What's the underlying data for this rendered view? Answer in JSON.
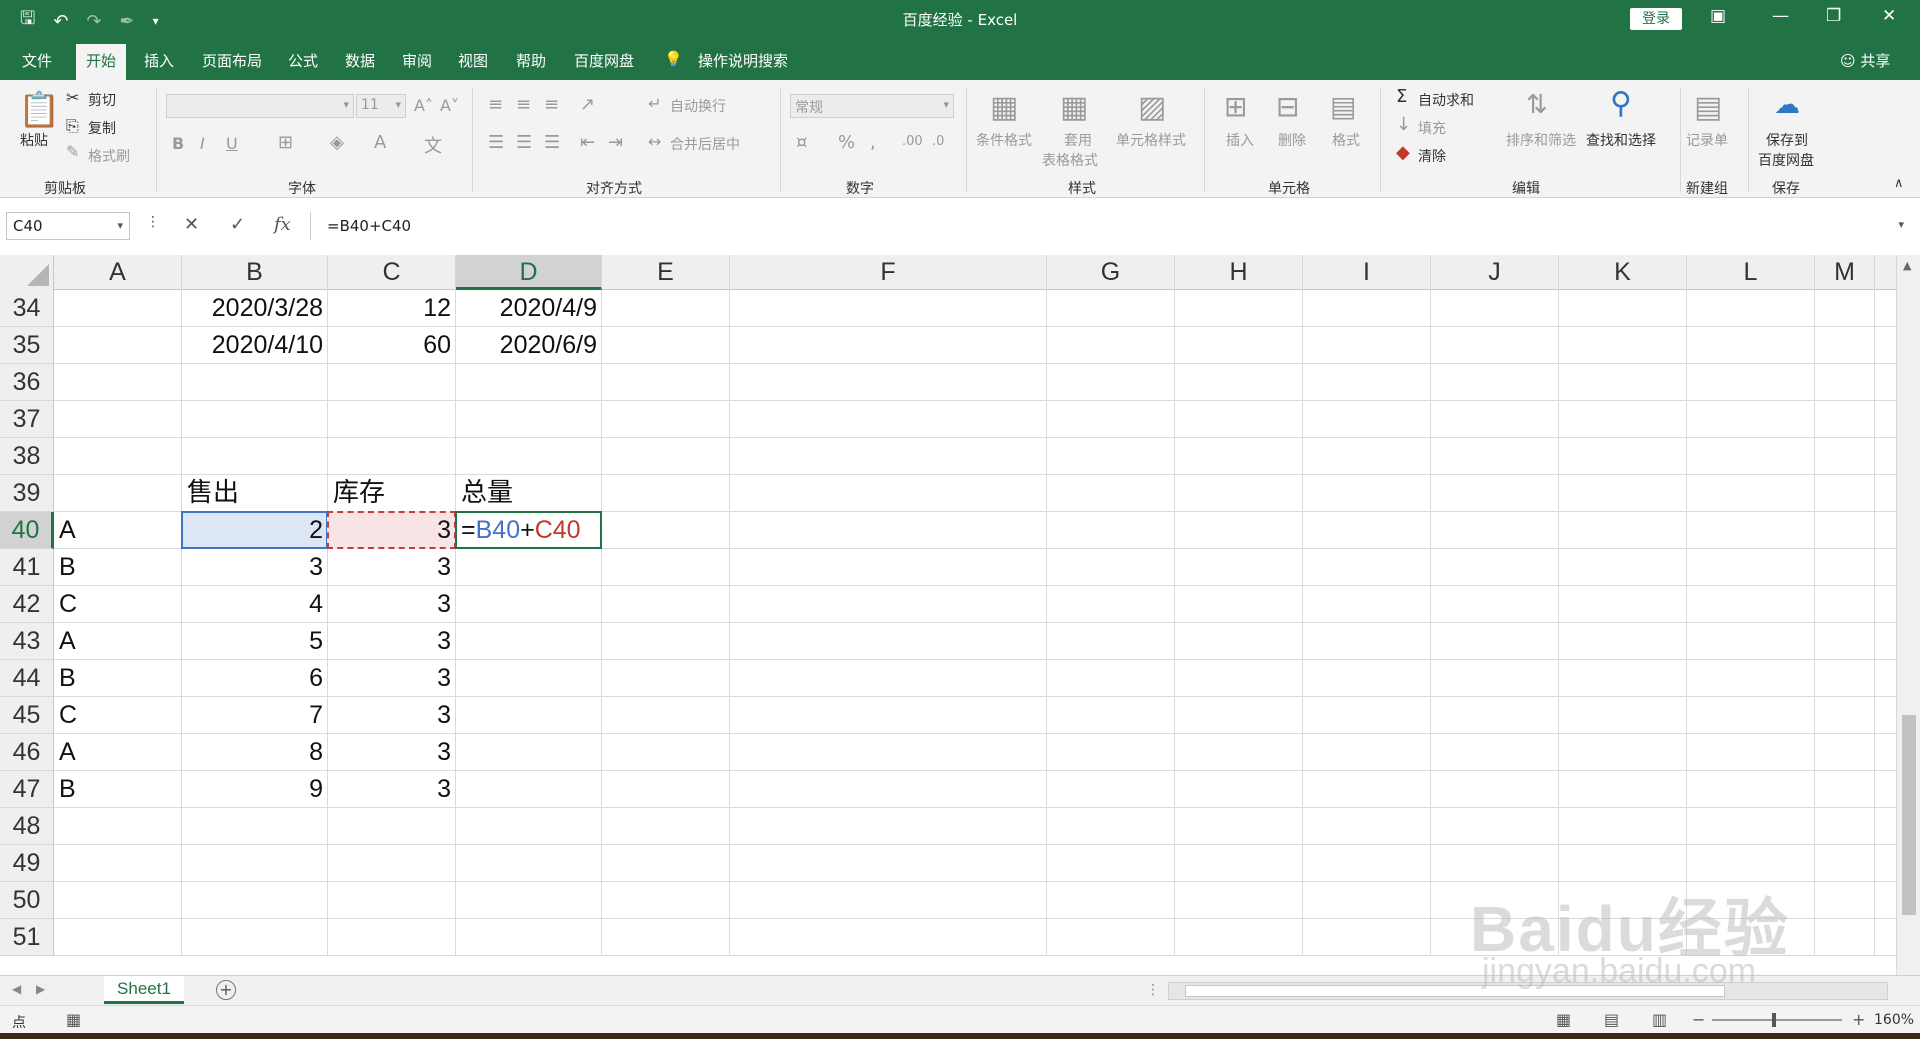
{
  "window": {
    "title": "百度经验  -  Excel",
    "login_label": "登录",
    "share_label": "共享"
  },
  "ribbon": {
    "tabs": [
      {
        "label": "文件"
      },
      {
        "label": "开始"
      },
      {
        "label": "插入"
      },
      {
        "label": "页面布局"
      },
      {
        "label": "公式"
      },
      {
        "label": "数据"
      },
      {
        "label": "审阅"
      },
      {
        "label": "视图"
      },
      {
        "label": "帮助"
      },
      {
        "label": "百度网盘"
      },
      {
        "label": "操作说明搜索"
      }
    ],
    "active_tab": "开始",
    "clipboard": {
      "paste": "粘贴",
      "cut": "剪切",
      "copy": "复制",
      "format_painter": "格式刷",
      "group_label": "剪贴板"
    },
    "font": {
      "font_size": "11",
      "group_label": "字体"
    },
    "alignment": {
      "wrap_text": "自动换行",
      "merge_center": "合并后居中",
      "group_label": "对齐方式"
    },
    "number": {
      "format": "常规",
      "group_label": "数字"
    },
    "styles": {
      "conditional": "条件格式",
      "table_format_1": "套用",
      "table_format_2": "表格格式",
      "cell_styles": "单元格样式",
      "group_label": "样式"
    },
    "cells": {
      "insert": "插入",
      "delete": "删除",
      "format": "格式",
      "group_label": "单元格"
    },
    "editing": {
      "autosum": "自动求和",
      "fill": "填充",
      "clear": "清除",
      "sort_filter": "排序和筛选",
      "find_select": "查找和选择",
      "group_label": "编辑"
    },
    "new_group": {
      "record": "记录单",
      "group_label": "新建组"
    },
    "save": {
      "save_to_1": "保存到",
      "save_to_2": "百度网盘",
      "group_label": "保存"
    }
  },
  "formula_bar": {
    "name_box": "C40",
    "formula": "=B40+C40",
    "fx_label": "fx"
  },
  "grid": {
    "columns": [
      "A",
      "B",
      "C",
      "D",
      "E",
      "F",
      "G",
      "H",
      "I",
      "J",
      "K",
      "L",
      "M"
    ],
    "selected_column": "D",
    "rows": [
      "34",
      "35",
      "36",
      "37",
      "38",
      "39",
      "40",
      "41",
      "42",
      "43",
      "44",
      "45",
      "46",
      "47",
      "48",
      "49",
      "50",
      "51"
    ],
    "selected_row": "40",
    "cells": {
      "B34": "2020/3/28",
      "C34": "12",
      "D34": "2020/4/9",
      "B35": "2020/4/10",
      "C35": "60",
      "D35": "2020/6/9",
      "B39": "售出",
      "C39": "库存",
      "D39": "总量",
      "A40": "A",
      "B40": "2",
      "C40": "3",
      "A41": "B",
      "B41": "3",
      "C41": "3",
      "A42": "C",
      "B42": "4",
      "C42": "3",
      "A43": "A",
      "B43": "5",
      "C43": "3",
      "A44": "B",
      "B44": "6",
      "C44": "3",
      "A45": "C",
      "B45": "7",
      "C45": "3",
      "A46": "A",
      "B46": "8",
      "C46": "3",
      "A47": "B",
      "B47": "9",
      "C47": "3"
    },
    "edit_cell": {
      "eq": "=",
      "ref1": "B40",
      "plus": "+",
      "ref2": "C40"
    }
  },
  "sheets": {
    "tabs": [
      "Sheet1"
    ],
    "add_label": "+"
  },
  "status": {
    "mode": "点",
    "zoom": "160%"
  },
  "watermark": {
    "text": "Baidu经验",
    "url": "jingyan.baidu.com"
  },
  "colors": {
    "excel_green": "#217346",
    "ref_blue": "#4472c4",
    "ref_red": "#c0392b"
  }
}
